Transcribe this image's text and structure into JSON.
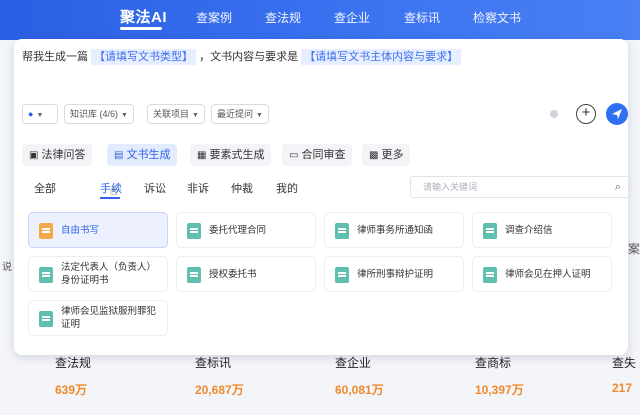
{
  "nav": {
    "brand": "聚法AI",
    "links": [
      "查案例",
      "查法规",
      "查企业",
      "查标讯",
      "检察文书"
    ]
  },
  "background": {
    "left_fragment": "说",
    "right_fragment": "案"
  },
  "prompt": {
    "prefix": "帮我生成一篇",
    "placeholder1": "【请填写文书类型】",
    "middle": "，文书内容与要求是",
    "placeholder2": "【请填写文书主体内容与要求】"
  },
  "controls": {
    "kb_label": "知识库 (4/6)",
    "related_label": "关联项目",
    "recent_label": "最近提问",
    "plus_symbol": "⊕"
  },
  "func_tabs": [
    {
      "label": "法律问答",
      "icon": "chat-icon"
    },
    {
      "label": "文书生成",
      "icon": "document-icon"
    },
    {
      "label": "要素式生成",
      "icon": "form-icon"
    },
    {
      "label": "合同审查",
      "icon": "contract-icon"
    },
    {
      "label": "更多",
      "icon": "grid-icon"
    }
  ],
  "sub_tabs": [
    "全部",
    "手续",
    "诉讼",
    "非诉",
    "仲裁",
    "我的"
  ],
  "search": {
    "placeholder": "请输入关键词"
  },
  "templates": [
    "自由书写",
    "委托代理合同",
    "律师事务所通知函",
    "调查介绍信",
    "法定代表人（负责人）身份证明书",
    "授权委托书",
    "律所刑事辩护证明",
    "律师会见在押人证明",
    "律师会见监狱服刑罪犯证明"
  ],
  "stats": [
    {
      "label": "查法规",
      "value": "639万"
    },
    {
      "label": "查标讯",
      "value": "20,687万"
    },
    {
      "label": "查企业",
      "value": "60,081万"
    },
    {
      "label": "查商标",
      "value": "10,397万"
    },
    {
      "label": "查失",
      "value": "217"
    }
  ],
  "colors": {
    "accent": "#2f64e6",
    "stat_value": "#f0892e"
  }
}
